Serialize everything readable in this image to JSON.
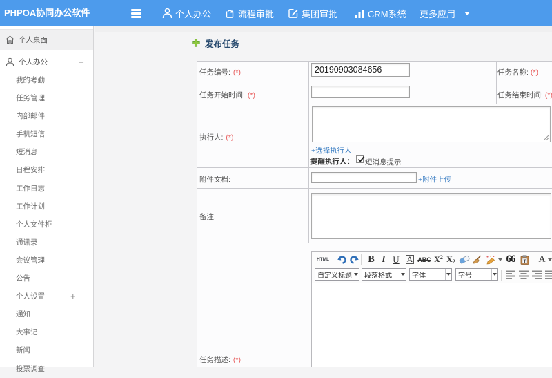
{
  "app": {
    "title": "PHPOA协同办公软件"
  },
  "topnav": {
    "items": [
      {
        "label": "个人办公",
        "icon": "user"
      },
      {
        "label": "流程审批",
        "icon": "process"
      },
      {
        "label": "集团审批",
        "icon": "edit-square"
      },
      {
        "label": "CRM系统",
        "icon": "bar-chart"
      },
      {
        "label": "更多应用",
        "icon": "caret-down"
      }
    ]
  },
  "sidebar": {
    "desktop_label": "个人桌面",
    "section": {
      "label": "个人办公",
      "collapse_symbol": "—",
      "items": [
        {
          "label": "我的考勤"
        },
        {
          "label": "任务管理"
        },
        {
          "label": "内部邮件"
        },
        {
          "label": "手机短信"
        },
        {
          "label": "短消息"
        },
        {
          "label": "日程安排"
        },
        {
          "label": "工作日志"
        },
        {
          "label": "工作计划"
        },
        {
          "label": "个人文件柜"
        },
        {
          "label": "通讯录"
        },
        {
          "label": "会议管理"
        },
        {
          "label": "公告"
        },
        {
          "label": "个人设置",
          "expand_symbol": "+"
        },
        {
          "label": "通知"
        },
        {
          "label": "大事记"
        },
        {
          "label": "新闻"
        },
        {
          "label": "投票调查"
        }
      ]
    }
  },
  "content": {
    "page_title": "发布任务",
    "form": {
      "task_number_label": "任务编号:",
      "task_number_required": "(*)",
      "task_number_value": "20190903084656",
      "task_name_label": "任务名称:",
      "task_name_required": "(*)",
      "start_time_label": "任务开始时间:",
      "start_time_required": "(*)",
      "end_time_label": "任务结束时间:",
      "end_time_required": "(*)",
      "executor_label": "执行人:",
      "executor_required": "(*)",
      "choose_executor_link": "+选择执行人",
      "remind_label": "提醒执行人：",
      "sms_checkbox_label": "短消息提示",
      "sms_checkbox_checked": true,
      "attachment_label": "附件文档:",
      "attachment_upload_link": "+附件上传",
      "note_label": "备注:",
      "description_label": "任务描述:",
      "description_required": "(*)"
    },
    "editor": {
      "html_label": "HTML",
      "bold_label": "B",
      "italic_label": "I",
      "underline_label": "U",
      "forecolor_label": "A",
      "strike_label": "ABC",
      "sup_base": "X",
      "sup_exp": "2",
      "sub_base": "X",
      "sub_exp": "2",
      "quote_label": "66",
      "textcolor_label": "A",
      "dropdowns": [
        {
          "label": "自定义标题"
        },
        {
          "label": "段落格式"
        },
        {
          "label": "字体"
        },
        {
          "label": "字号"
        }
      ]
    }
  },
  "colors": {
    "topbar": "#4191e1",
    "link": "#3a7cc4",
    "required": "#e85c5c",
    "title": "#2a4c70",
    "plus_icon_green": "#7cbf3f"
  }
}
